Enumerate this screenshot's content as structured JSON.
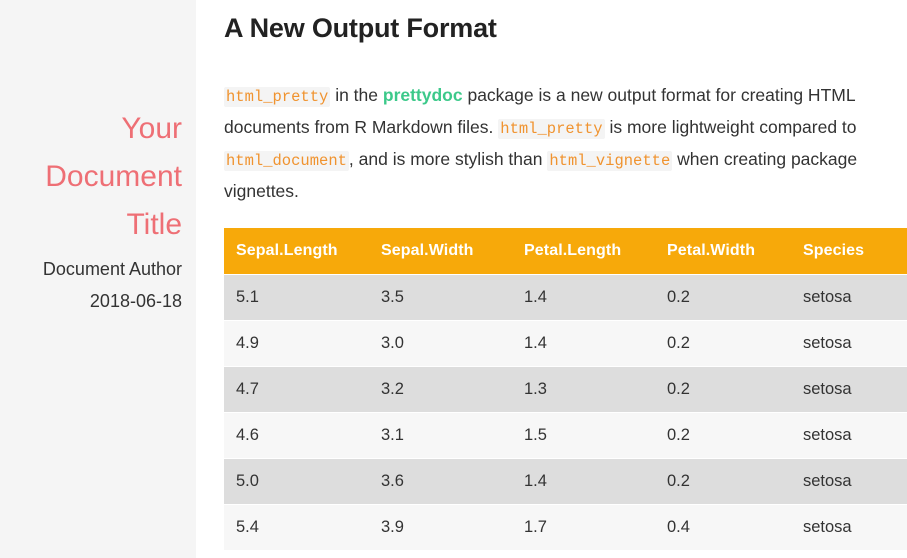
{
  "sidebar": {
    "title": "Your Document Title",
    "author": "Document Author",
    "date": "2018-06-18",
    "title_color": "#ee6f75",
    "background": "#f5f5f5"
  },
  "main": {
    "heading": "A New Output Format",
    "paragraph": {
      "segments": [
        {
          "type": "code",
          "text": "html_pretty"
        },
        {
          "type": "text",
          "text": " in the "
        },
        {
          "type": "link",
          "text": "prettydoc"
        },
        {
          "type": "text",
          "text": " package is a new output format for creating HTML documents from R Markdown files. "
        },
        {
          "type": "code",
          "text": "html_pretty"
        },
        {
          "type": "text",
          "text": " is more lightweight compared to "
        },
        {
          "type": "code",
          "text": "html_document"
        },
        {
          "type": "text",
          "text": ", and is more stylish than "
        },
        {
          "type": "code",
          "text": "html_vignette"
        },
        {
          "type": "text",
          "text": " when creating package vignettes."
        }
      ],
      "code_color": "#f0932f",
      "link_color": "#3cc98a"
    }
  },
  "table": {
    "header_background": "#f7a90a",
    "header_text_color": "#ffffff",
    "stripe_odd": "#dddddd",
    "stripe_even": "#f7f7f7",
    "columns": [
      "Sepal.Length",
      "Sepal.Width",
      "Petal.Length",
      "Petal.Width",
      "Species"
    ],
    "rows": [
      [
        "5.1",
        "3.5",
        "1.4",
        "0.2",
        "setosa"
      ],
      [
        "4.9",
        "3.0",
        "1.4",
        "0.2",
        "setosa"
      ],
      [
        "4.7",
        "3.2",
        "1.3",
        "0.2",
        "setosa"
      ],
      [
        "4.6",
        "3.1",
        "1.5",
        "0.2",
        "setosa"
      ],
      [
        "5.0",
        "3.6",
        "1.4",
        "0.2",
        "setosa"
      ],
      [
        "5.4",
        "3.9",
        "1.7",
        "0.4",
        "setosa"
      ]
    ]
  }
}
